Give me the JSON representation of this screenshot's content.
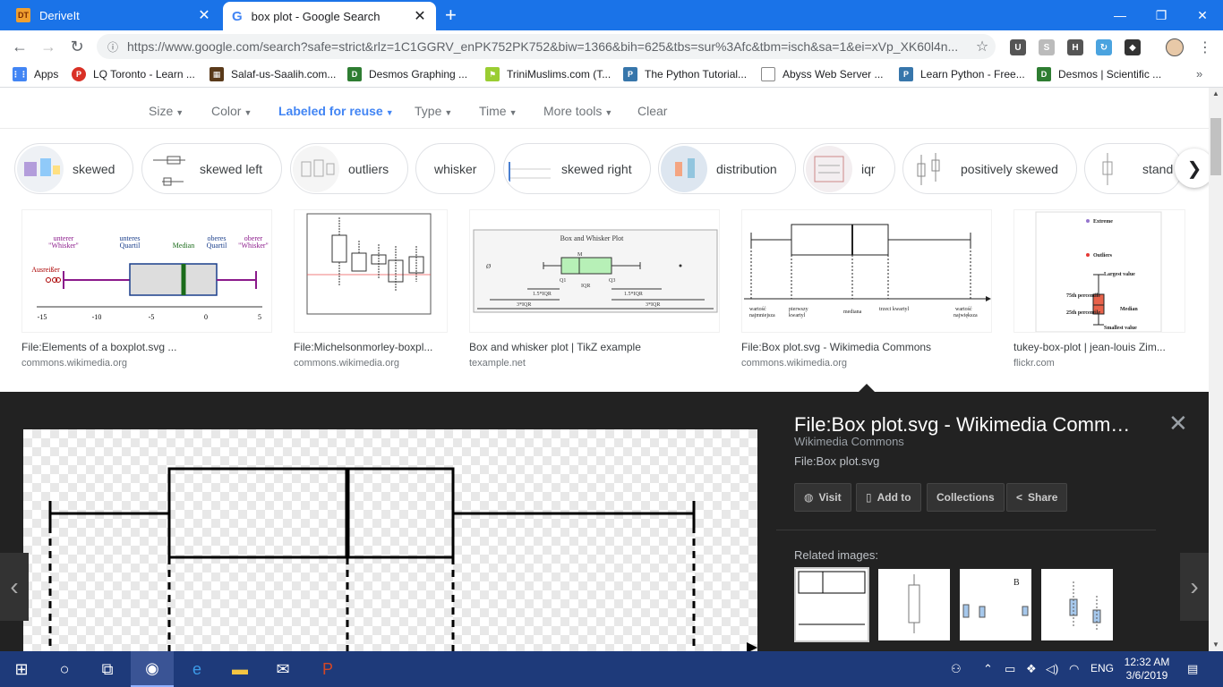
{
  "browser": {
    "tabs": [
      {
        "title": "DeriveIt",
        "favicon": "deriveit-icon"
      },
      {
        "title": "box plot - Google Search",
        "favicon": "google-icon"
      }
    ],
    "url": "https://www.google.com/search?safe=strict&rlz=1C1GGRV_enPK752PK752&biw=1366&bih=625&tbs=sur%3Afc&tbm=isch&sa=1&ei=xVp_XK60l4n...",
    "bookmarks": [
      {
        "label": "Apps",
        "color": "#4285f4"
      },
      {
        "label": "LQ Toronto - Learn ...",
        "color": "#d93025"
      },
      {
        "label": "Salaf-us-Saalih.com...",
        "color": "#5a3a1a"
      },
      {
        "label": "Desmos Graphing ...",
        "color": "#2e7d32"
      },
      {
        "label": "TriniMuslims.com (T...",
        "color": "#9acd32"
      },
      {
        "label": "The Python Tutorial...",
        "color": "#3776ab"
      },
      {
        "label": "Abyss Web Server ...",
        "color": "#888888"
      },
      {
        "label": "Learn Python - Free...",
        "color": "#3776ab"
      },
      {
        "label": "Desmos | Scientific ...",
        "color": "#2e7d32"
      }
    ]
  },
  "tools": {
    "size": "Size",
    "color": "Color",
    "labeled": "Labeled for reuse",
    "type": "Type",
    "time": "Time",
    "more": "More tools",
    "clear": "Clear"
  },
  "chips": [
    "skewed",
    "skewed left",
    "outliers",
    "whisker",
    "skewed right",
    "distribution",
    "iqr",
    "positively skewed",
    "stand"
  ],
  "results": [
    {
      "title": "File:Elements of a boxplot.svg ...",
      "source": "commons.wikimedia.org"
    },
    {
      "title": "File:Michelsonmorley-boxpl...",
      "source": "commons.wikimedia.org"
    },
    {
      "title": "Box and whisker plot | TikZ example",
      "source": "texample.net"
    },
    {
      "title": "File:Box plot.svg - Wikimedia Commons",
      "source": "commons.wikimedia.org"
    },
    {
      "title": "tukey-box-plot | jean-louis Zim...",
      "source": "flickr.com"
    }
  ],
  "thumb1": {
    "lab_lw": "unterer",
    "lab_lw2": "\"Whisker\"",
    "lab_lq": "unteres",
    "lab_lq2": "Quartil",
    "lab_med": "Median",
    "lab_uq": "oberes",
    "lab_uq2": "Quartil",
    "lab_uw": "oberer",
    "lab_uw2": "\"Whisker\"",
    "lab_out": "Ausreißer",
    "ticks": [
      "-15",
      "-10",
      "-5",
      "0",
      "5"
    ]
  },
  "thumb3": {
    "title": "Box and Whisker Plot",
    "m": "M",
    "q1": "Q1",
    "q3": "Q3",
    "iqr": "IQR",
    "iqr15a": "1.5*IQR",
    "iqr15b": "1.5*IQR",
    "iqr3a": "3*IQR",
    "iqr3b": "3*IQR"
  },
  "thumb4": {
    "l1": "wartość",
    "l1b": "najmniejsza",
    "l2": "pierwszy",
    "l2b": "kwartyl",
    "l3": "mediana",
    "l4": "trzeci kwartyl",
    "l5": "wartość",
    "l5b": "największa"
  },
  "thumb5": {
    "extreme": "Extreme",
    "outliers": "Outliers",
    "largest": "Largest value",
    "p75": "75th percentile",
    "median": "Median",
    "p25": "25th percentile",
    "smallest": "Smallest value"
  },
  "viewer": {
    "title": "File:Box plot.svg - Wikimedia Comm…",
    "site": "Wikimedia Commons",
    "file": "File:Box plot.svg",
    "actions": [
      "Visit",
      "Add to",
      "Collections",
      "Share"
    ],
    "related_label": "Related images:"
  },
  "taskbar": {
    "lang": "ENG",
    "time": "12:32 AM",
    "date": "3/6/2019"
  }
}
